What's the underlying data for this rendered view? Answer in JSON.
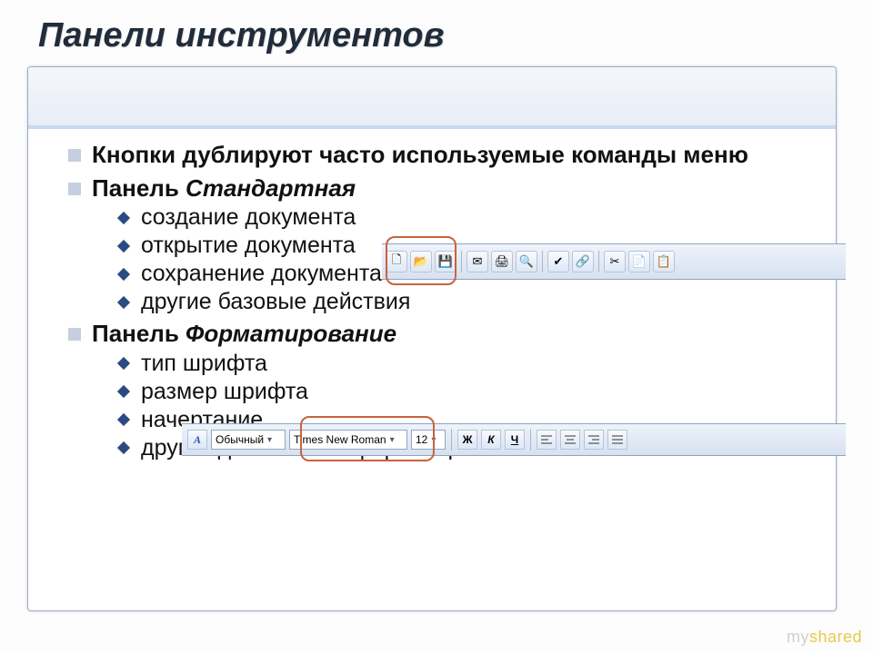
{
  "title": "Панели инструментов",
  "bullets": {
    "b1": "Кнопки дублируют часто используемые команды меню",
    "b2_prefix": "Панель ",
    "b2_italic": "Стандартная",
    "b2_sub1": "создание документа",
    "b2_sub2": "открытие документа",
    "b2_sub3": "сохранение документа",
    "b2_sub4": "другие базовые действия",
    "b3_prefix": "Панель ",
    "b3_italic": "Форматирование",
    "b3_sub1": "тип шрифта",
    "b3_sub2": "размер шрифта",
    "b3_sub3": "начертание",
    "b3_sub4": "другие действия по форматированию"
  },
  "toolbar_std": {
    "icons": [
      "🗋",
      "📂",
      "💾",
      "✉",
      "🖨",
      "🔍",
      "✔",
      "🔗",
      "✂",
      "📄",
      "📋"
    ]
  },
  "toolbar_fmt": {
    "aa": "A",
    "style": "Обычный",
    "font": "Times New Roman",
    "size": "12",
    "bold": "Ж",
    "italic": "К",
    "underline": "Ч"
  },
  "watermark": {
    "p1": "my",
    "p2": "shared"
  }
}
